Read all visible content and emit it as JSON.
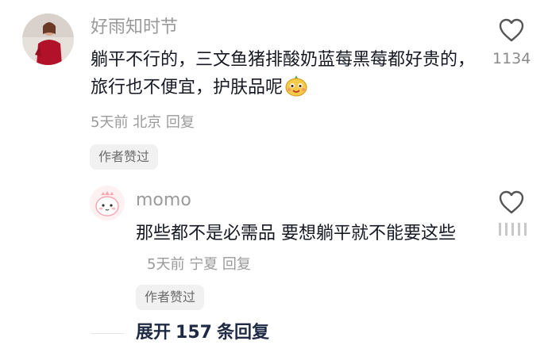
{
  "comments": [
    {
      "username": "好雨知时节",
      "text": "躺平不行的，三文鱼猪排酸奶蓝莓黑莓都好贵的，旅行也不便宜，护肤品呢",
      "time": "5天前",
      "location": "北京",
      "reply_label": "回复",
      "badge": "作者赞过",
      "like_count": "1134",
      "avatar_icon": "avatar-woman-red-dress",
      "emoji_icon": "smiling-cartoon-face-emoji"
    }
  ],
  "reply": {
    "username": "momo",
    "text": "那些都不是必需品 要想躺平就不能要这些",
    "time": "5天前",
    "location": "宁夏",
    "reply_label": "回复",
    "badge": "作者赞过",
    "avatar_icon": "avatar-pink-cartoon",
    "like_count_icon": "blurred-like-count"
  },
  "expand": {
    "prefix": "展开",
    "count": "157",
    "suffix": "条回复"
  },
  "colors": {
    "text_primary": "#161823",
    "text_secondary": "#9a9a9a",
    "badge_bg": "#f1f1f2",
    "expand_text": "#1f2a44"
  }
}
